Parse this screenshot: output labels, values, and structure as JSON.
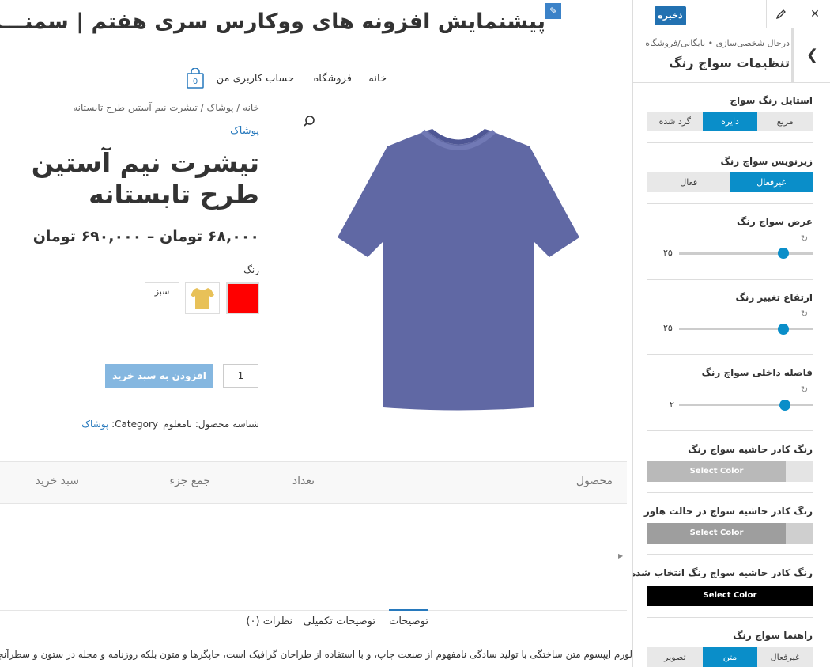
{
  "preview": {
    "site_title": "پیشنمایش افزونه های ووکارس سری هفتم | سمنـــدون",
    "nav": {
      "home": "خانه",
      "shop": "فروشگاه",
      "account": "حساب کاربری من",
      "cart_count": "0"
    },
    "breadcrumb": "خانه / پوشاک / تیشرت نیم آستین طرح تابستانه",
    "category": "پوشاک",
    "product_title": "تیشرت نیم آستین طرح تابستانه",
    "price": "۶۸,۰۰۰ تومان – ۶۹۰,۰۰۰ تومان",
    "color_label": "رنگ",
    "swatch_text": "سبز",
    "quantity": "1",
    "add_to_cart": "افزودن به سبد خرید",
    "sku_label": "شناسه محصول:",
    "sku_value": "نامعلوم",
    "category_label": "Category:",
    "category_value": "پوشاک",
    "table": {
      "product": "محصول",
      "qty": "تعداد",
      "subtotal": "جمع جزء",
      "cart": "سبد خرید"
    },
    "tabs": {
      "description": "توضیحات",
      "additional": "توضیحات تکمیلی",
      "reviews": "نظرات (۰)"
    },
    "description_text": "لورم ایپسوم متن ساختگی با تولید سادگی نامفهوم از صنعت چاپ، و با استفاده از طراحان گرافیک است، چاپگرها و متون بلکه روزنامه و مجله در ستون و سطرآنچنان که لازم است"
  },
  "panel": {
    "save": "ذخیره",
    "crumb": "درحال شخصی‌سازی • بایگانی/فروشگاه",
    "title": "تنظیمات سواچ رنگ",
    "style": {
      "label": "استایل رنگ سواچ",
      "square": "مربع",
      "circle": "دایره",
      "rounded": "گرد شده"
    },
    "subtitle": {
      "label": "زیرنویس سواچ رنگ",
      "disabled": "غیرفعال",
      "enabled": "فعال"
    },
    "width": {
      "label": "عرض سواچ رنگ",
      "value": "۲۵",
      "fraction": 0.78
    },
    "height": {
      "label": "ارتفاع تغییر رنگ",
      "value": "۲۵",
      "fraction": 0.78
    },
    "padding": {
      "label": "فاصله داخلی سواچ رنگ",
      "value": "۲",
      "fraction": 0.79
    },
    "border_color": {
      "label": "رنگ کادر حاشیه سواچ رنگ",
      "button": "Select Color",
      "color": "#b9b9b9"
    },
    "hover_color": {
      "label": "رنگ کادر حاشیه سواچ در حالت هاور",
      "button": "Select Color",
      "color": "#9e9e9e"
    },
    "selected_color": {
      "label": "رنگ کادر حاشیه سواچ رنگ انتخاب شده",
      "button": "Select Color",
      "color": "#000000"
    },
    "guide": {
      "label": "راهنما سواچ رنگ",
      "disabled": "غیرفعال",
      "text": "متن",
      "image": "تصویر"
    }
  }
}
